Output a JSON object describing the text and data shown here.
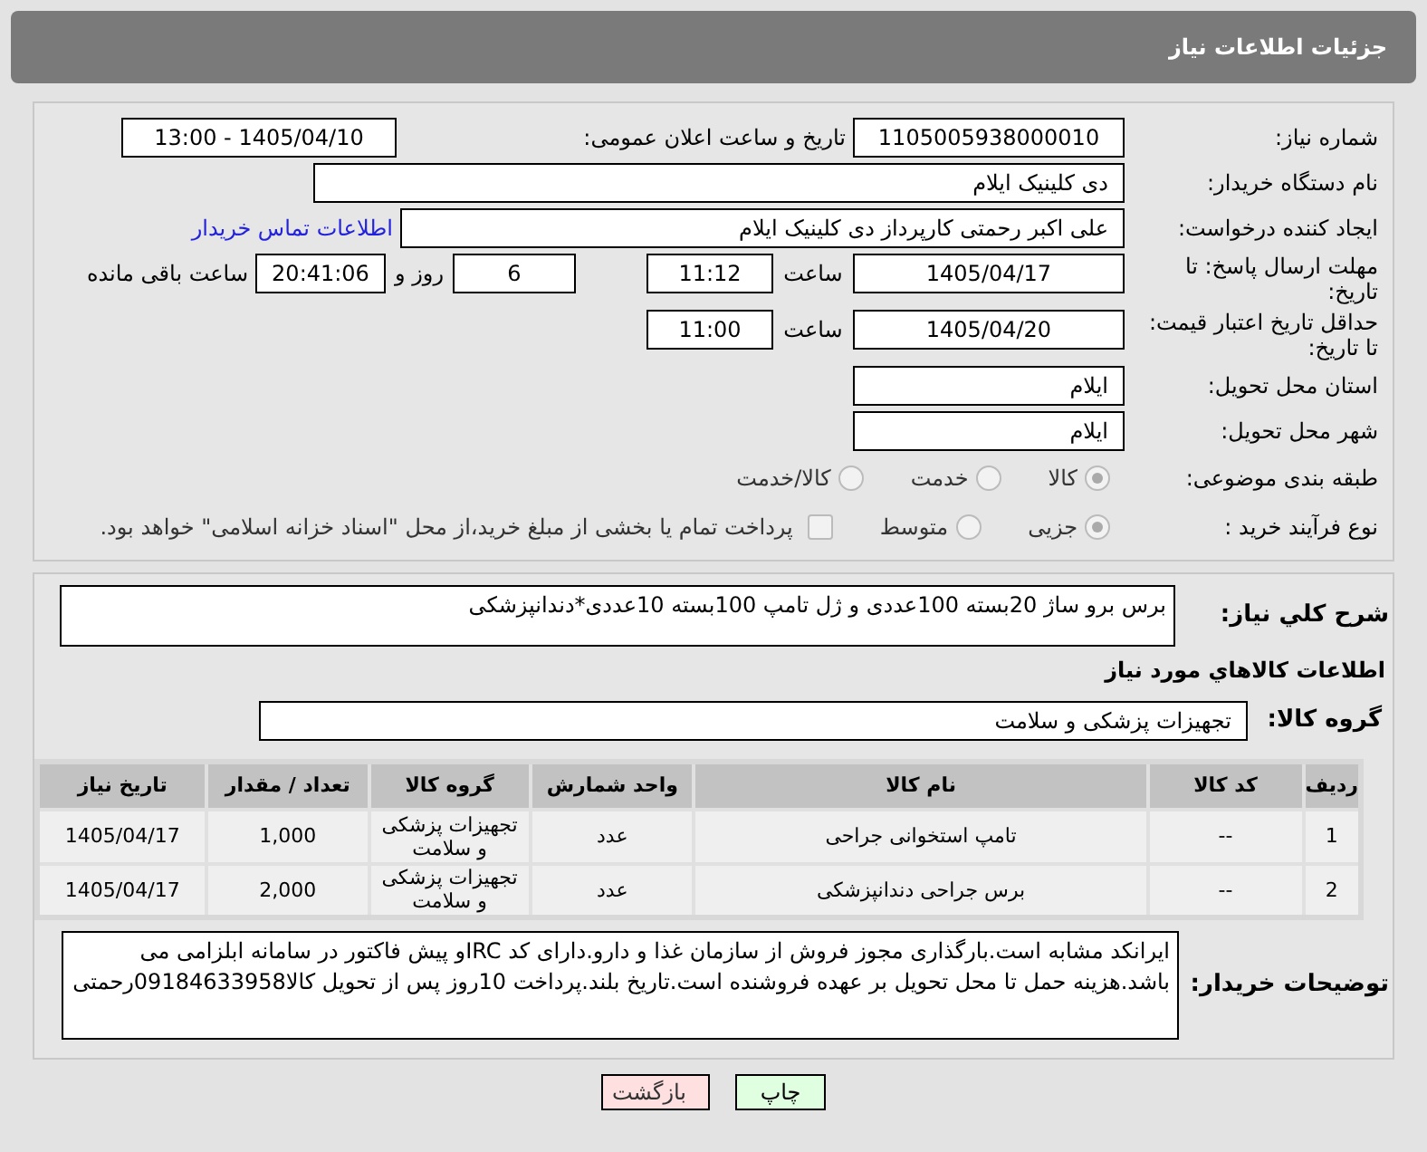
{
  "header": {
    "title": "جزئیات اطلاعات نیاز"
  },
  "need_number": {
    "label": "شماره نیاز:",
    "value": "1105005938000010"
  },
  "announce": {
    "label": "تاریخ و ساعت اعلان عمومی:",
    "value": "1405/04/10 - 13:00"
  },
  "buyer_org": {
    "label": "نام دستگاه خریدار:",
    "value": "دی کلینیک ایلام"
  },
  "requester": {
    "label": "ایجاد کننده درخواست:",
    "value": "علی اکبر رحمتی کارپرداز دی کلینیک ایلام",
    "link": "اطلاعات تماس خریدار"
  },
  "deadline": {
    "label": "مهلت ارسال پاسخ: تا تاریخ:",
    "date": "1405/04/17",
    "time_label": "ساعت",
    "time": "11:12",
    "days": "6",
    "days_label": "روز و",
    "remaining": "20:41:06",
    "remaining_label": "ساعت باقی مانده"
  },
  "validity": {
    "label": "حداقل تاریخ اعتبار قیمت: تا تاریخ:",
    "date": "1405/04/20",
    "time_label": "ساعت",
    "time": "11:00"
  },
  "province": {
    "label": "استان محل تحویل:",
    "value": "ایلام"
  },
  "city": {
    "label": "شهر محل تحویل:",
    "value": "ایلام"
  },
  "category": {
    "label": "طبقه بندی موضوعی:",
    "options": [
      {
        "label": "کالا",
        "selected": true
      },
      {
        "label": "خدمت",
        "selected": false
      },
      {
        "label": "کالا/خدمت",
        "selected": false
      }
    ]
  },
  "process": {
    "label": "نوع فرآیند خرید :",
    "options": [
      {
        "label": "جزیی",
        "selected": true
      },
      {
        "label": "متوسط",
        "selected": false
      }
    ],
    "payment": {
      "checked": false,
      "text": "پرداخت تمام یا بخشی از مبلغ خرید،از محل \"اسناد خزانه اسلامی\" خواهد بود."
    }
  },
  "description": {
    "label": "شرح کلي نياز:",
    "value": "برس برو ساژ 20بسته 100عددی و ژل تامپ 100بسته 10عددی*دندانپزشکی"
  },
  "goods_heading": "اطلاعات کالاهاي مورد نياز",
  "goods_group": {
    "label": "گروه کالا:",
    "value": "تجهیزات پزشکی و سلامت"
  },
  "table": {
    "columns": [
      "ردیف",
      "کد کالا",
      "نام کالا",
      "واحد شمارش",
      "گروه کالا",
      "تعداد / مقدار",
      "تاریخ نیاز"
    ],
    "rows": [
      [
        "1",
        "--",
        "تامپ استخوانی جراحی",
        "عدد",
        "تجهیزات پزشکی و سلامت",
        "1,000",
        "1405/04/17"
      ],
      [
        "2",
        "--",
        "برس جراحی دندانپزشکی",
        "عدد",
        "تجهیزات پزشکی و سلامت",
        "2,000",
        "1405/04/17"
      ]
    ]
  },
  "buyer_notes": {
    "label": "توضیحات خریدار:",
    "value": "ایرانکد مشابه است.بارگذاری مجوز فروش از سازمان غذا و دارو.دارای کد IRCو پیش فاکتور در سامانه ابلزامی می باشد.هزینه حمل تا محل تحویل بر عهده فروشنده است.تاریخ بلند.پرداخت 10روز پس از تحویل کالا09184633958رحمتی"
  },
  "buttons": [
    {
      "label": "چاپ",
      "kind": "print"
    },
    {
      "label": "بازگشت",
      "kind": "back"
    }
  ]
}
